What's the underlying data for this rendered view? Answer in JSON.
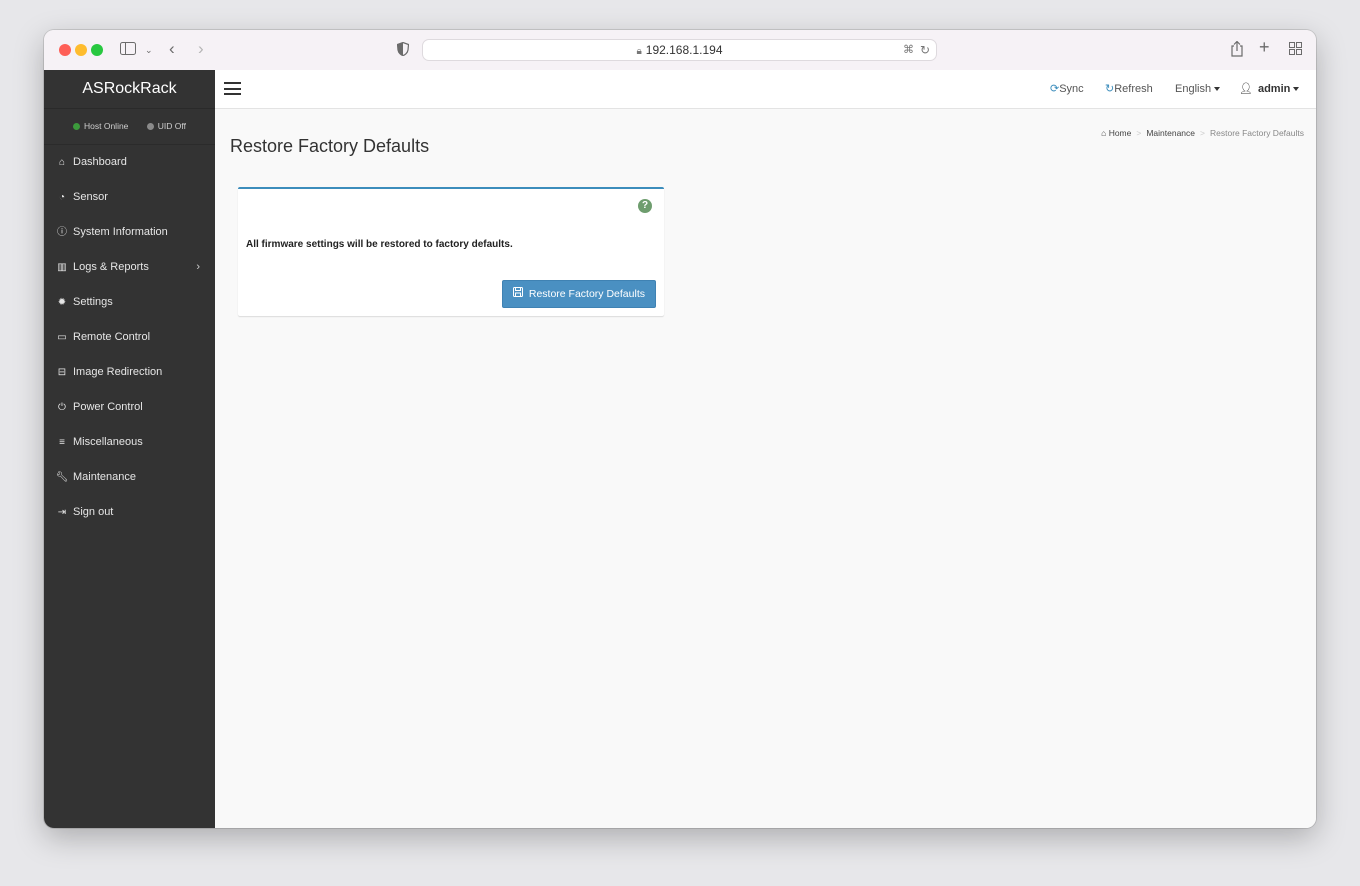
{
  "browser": {
    "address": "192.168.1.194"
  },
  "sidebar": {
    "brand": "ASRockRack",
    "status": {
      "host": "Host Online",
      "uid": "UID Off"
    },
    "items": [
      {
        "label": "Dashboard",
        "icon": "home-icon"
      },
      {
        "label": "Sensor",
        "icon": "tachometer-icon"
      },
      {
        "label": "System Information",
        "icon": "info-icon"
      },
      {
        "label": "Logs & Reports",
        "icon": "bar-chart-icon"
      },
      {
        "label": "Settings",
        "icon": "gear-icon"
      },
      {
        "label": "Remote Control",
        "icon": "monitor-icon"
      },
      {
        "label": "Image Redirection",
        "icon": "drive-icon"
      },
      {
        "label": "Power Control",
        "icon": "power-icon"
      },
      {
        "label": "Miscellaneous",
        "icon": "list-icon"
      },
      {
        "label": "Maintenance",
        "icon": "wrench-icon"
      },
      {
        "label": "Sign out",
        "icon": "sign-out-icon"
      }
    ]
  },
  "header": {
    "sync": "Sync",
    "refresh": "Refresh",
    "language": "English",
    "user": "admin"
  },
  "page": {
    "title": "Restore Factory Defaults",
    "breadcrumb": [
      "Home",
      "Maintenance",
      "Restore Factory Defaults"
    ],
    "message": "All firmware settings will be restored to factory defaults.",
    "button": "Restore Factory Defaults"
  },
  "colors": {
    "sidebar_bg": "#333333",
    "accent": "#3c8dbc",
    "button": "#4a90c2",
    "host_online": "#3c9a3c"
  }
}
